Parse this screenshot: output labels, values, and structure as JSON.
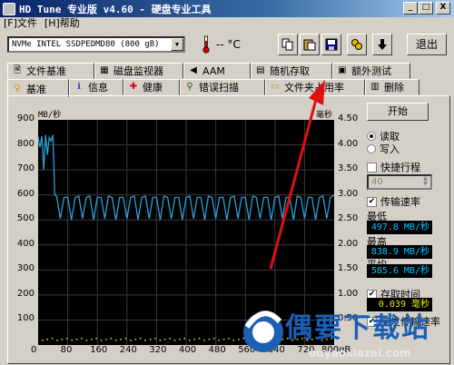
{
  "window": {
    "title": "HD Tune 专业版 v4.60 - 硬盘专业工具",
    "minimize": "_",
    "maximize": "□",
    "close": "X"
  },
  "menu": [
    "[F]文件",
    "[H]帮助"
  ],
  "toolbar": {
    "drive": "NVMe    INTEL SSDPEDMD80 (800 gB)",
    "temperature": "-- °C",
    "exit_label": "退出",
    "icons": [
      "copy-icon",
      "paste-icon",
      "save-icon",
      "options-icon",
      "download-icon"
    ]
  },
  "tabs_top": [
    {
      "label": "文件基准",
      "icon": "file-benchmark-icon"
    },
    {
      "label": "磁盘监视器",
      "icon": "disk-monitor-icon"
    },
    {
      "label": "AAM",
      "icon": "speaker-icon"
    },
    {
      "label": "随机存取",
      "icon": "random-access-icon"
    },
    {
      "label": "额外测试",
      "icon": "extra-tests-icon"
    }
  ],
  "tabs_bottom": [
    {
      "label": "基准",
      "icon": "benchmark-icon",
      "active": true
    },
    {
      "label": "信息",
      "icon": "info-icon"
    },
    {
      "label": "健康",
      "icon": "health-cross-icon"
    },
    {
      "label": "错误扫描",
      "icon": "magnifier-icon"
    },
    {
      "label": "文件夹占用率",
      "icon": "folder-icon"
    },
    {
      "label": "删除",
      "icon": "trash-icon"
    }
  ],
  "graph": {
    "left_unit": "MB/秒",
    "right_unit": "毫秒",
    "y_left": [
      900,
      800,
      700,
      600,
      500,
      400,
      300,
      200,
      100
    ],
    "y_right": [
      "4.50",
      "4.00",
      "3.50",
      "3.00",
      "2.50",
      "2.00",
      "1.50",
      "1.00",
      "0.50"
    ],
    "x_ticks": [
      "0",
      "80",
      "160",
      "240",
      "320",
      "400",
      "480",
      "560",
      "640",
      "720",
      "800gB"
    ]
  },
  "controls": {
    "start_label": "开始",
    "read_label": "读取",
    "write_label": "写入",
    "short_stroke_label": "快捷行程",
    "short_stroke_value": "40",
    "transfer_rate_label": "传输速率",
    "min_label": "最低",
    "min_value": "497.8 MB/秒",
    "max_label": "最高",
    "max_value": "838.9 MB/秒",
    "avg_label": "平均",
    "avg_value": "585.6 MB/秒",
    "access_time_label": "存取时间",
    "access_time_value": "0.039 毫秒",
    "burst_label": "突发传输速率"
  },
  "chart_data": {
    "type": "line",
    "title": "",
    "xlabel": "",
    "ylabel": "MB/秒",
    "ylabel_right": "毫秒",
    "xlim": [
      0,
      800
    ],
    "ylim": [
      0,
      900
    ],
    "ylim_right": [
      0,
      5
    ],
    "grid": true,
    "series": [
      {
        "x": [
          0,
          5,
          10,
          15,
          20,
          25,
          30,
          35,
          40,
          45,
          50,
          60,
          70,
          80,
          90,
          100,
          110,
          120,
          130,
          140,
          150,
          160,
          170,
          180,
          190,
          200,
          210,
          220,
          230,
          240,
          250,
          260,
          270,
          280,
          290,
          300,
          310,
          320,
          330,
          340,
          350,
          360,
          370,
          380,
          390,
          400,
          410,
          420,
          430,
          440,
          450,
          460,
          470,
          480,
          490,
          500,
          510,
          520,
          530,
          540,
          550,
          560,
          570,
          580,
          590,
          600,
          610,
          620,
          630,
          640,
          650,
          660,
          670,
          680,
          690,
          700,
          710,
          720,
          730,
          740,
          750,
          760,
          770,
          780,
          790,
          800
        ],
        "values": [
          830,
          790,
          835,
          700,
          840,
          760,
          830,
          815,
          840,
          600,
          595,
          505,
          590,
          590,
          500,
          590,
          595,
          505,
          590,
          595,
          500,
          590,
          590,
          505,
          595,
          590,
          500,
          590,
          590,
          505,
          590,
          595,
          500,
          590,
          595,
          505,
          590,
          590,
          500,
          595,
          590,
          505,
          590,
          590,
          500,
          590,
          595,
          505,
          590,
          590,
          500,
          595,
          590,
          505,
          590,
          590,
          500,
          590,
          595,
          505,
          590,
          590,
          500,
          595,
          590,
          505,
          590,
          590,
          500,
          590,
          595,
          505,
          590,
          590,
          500,
          595,
          590,
          505,
          590,
          590,
          500,
          590,
          595,
          505,
          590,
          600
        ]
      }
    ]
  }
}
